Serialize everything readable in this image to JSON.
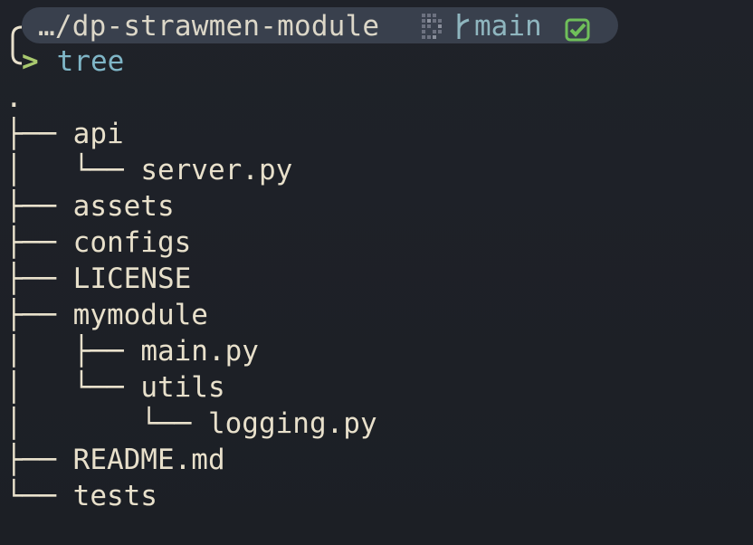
{
  "prompt": {
    "cwd": "…/dp-strawmen-module",
    "branch": "main",
    "arrow": ">",
    "command": "tree"
  },
  "tree": {
    "root": ".",
    "lines": [
      {
        "prefix": "├── ",
        "name": "api"
      },
      {
        "prefix": "│   └── ",
        "name": "server.py"
      },
      {
        "prefix": "├── ",
        "name": "assets"
      },
      {
        "prefix": "├── ",
        "name": "configs"
      },
      {
        "prefix": "├── ",
        "name": "LICENSE"
      },
      {
        "prefix": "├── ",
        "name": "mymodule"
      },
      {
        "prefix": "│   ├── ",
        "name": "main.py"
      },
      {
        "prefix": "│   └── ",
        "name": "utils"
      },
      {
        "prefix": "│       └── ",
        "name": "logging.py"
      },
      {
        "prefix": "├── ",
        "name": "README.md"
      },
      {
        "prefix": "└── ",
        "name": "tests"
      }
    ]
  },
  "colors": {
    "background": "#1e2128",
    "prompt_bar": "#39404d",
    "text": "#e8e0cb",
    "branch": "#8fb6bf",
    "arrow": "#a9c96f",
    "command": "#7fb6c7",
    "check": "#6fbf5a"
  },
  "icons": {
    "git_status": "dotted-git-icon",
    "branch": "git-branch-icon",
    "clean": "check-square-icon"
  }
}
